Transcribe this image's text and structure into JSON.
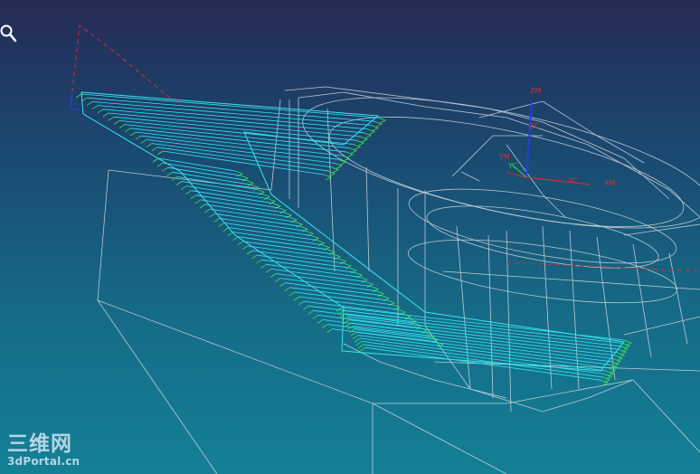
{
  "axes": {
    "wcs_z": "ZM",
    "wcs_x": "XM",
    "wcs_y": "YM",
    "mcs_z": "ZC",
    "mcs_x": "XC",
    "mcs_y": "YC"
  },
  "watermark": {
    "top": "三维网",
    "bottom": "3dPortal.cn"
  },
  "colors": {
    "background_top": "#272a54",
    "background_bottom": "#138096",
    "part_wireframe": "#d8dde6",
    "toolpath_cut": "#33e6f0",
    "toolpath_engage": "#40e060",
    "axis_red": "#d03030",
    "axis_blue": "#2a3ae0"
  },
  "icons": {
    "cursor": "magnifier-icon"
  }
}
